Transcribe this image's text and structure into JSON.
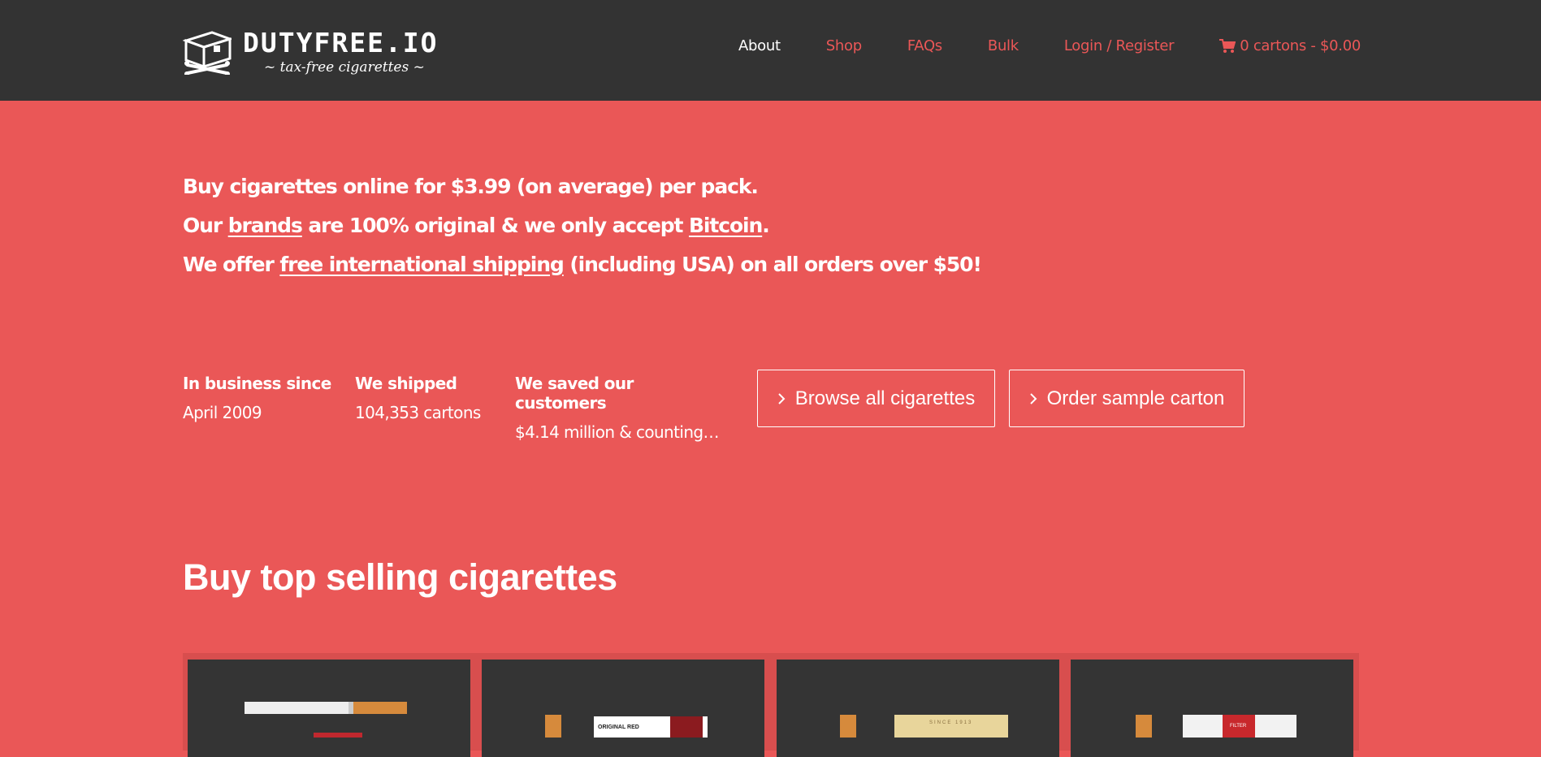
{
  "brand": {
    "name": "DUTYFREE.IO",
    "tagline": "~ tax-free cigarettes ~"
  },
  "nav": {
    "items": [
      {
        "label": "About",
        "active": true
      },
      {
        "label": "Shop"
      },
      {
        "label": "FAQs"
      },
      {
        "label": "Bulk"
      },
      {
        "label": "Login / Register"
      }
    ],
    "cart_label": "0 cartons - $0.00"
  },
  "intro": {
    "line1": "Buy cigarettes online for $3.99 (on average) per pack.",
    "line2_pre": "Our ",
    "line2_link1": "brands",
    "line2_mid": " are 100% original & we only accept ",
    "line2_link2": "Bitcoin",
    "line2_post": ".",
    "line3_pre": "We offer ",
    "line3_link": "free international shipping",
    "line3_post": " (including USA) on all orders over $50!"
  },
  "stats": [
    {
      "label": "In business since",
      "value": "April 2009"
    },
    {
      "label": "We shipped",
      "value": "104,353 cartons"
    },
    {
      "label": "We saved our customers",
      "value": "$4.14 million & counting…"
    }
  ],
  "buttons": {
    "browse": "Browse all cigarettes",
    "sample": "Order sample carton"
  },
  "section_title": "Buy top selling cigarettes",
  "products": [
    {
      "pack_label": "",
      "icon": "cigarette-image"
    },
    {
      "pack_label": "ORIGINAL RED",
      "icon": "cigarette-pack-image"
    },
    {
      "pack_label": "SINCE 1913",
      "icon": "cigarette-pack-image"
    },
    {
      "pack_label": "FILTER",
      "icon": "cigarette-pack-image"
    }
  ],
  "colors": {
    "accent": "#ea5757",
    "header_bg": "#333333",
    "card_bg": "#343434"
  }
}
